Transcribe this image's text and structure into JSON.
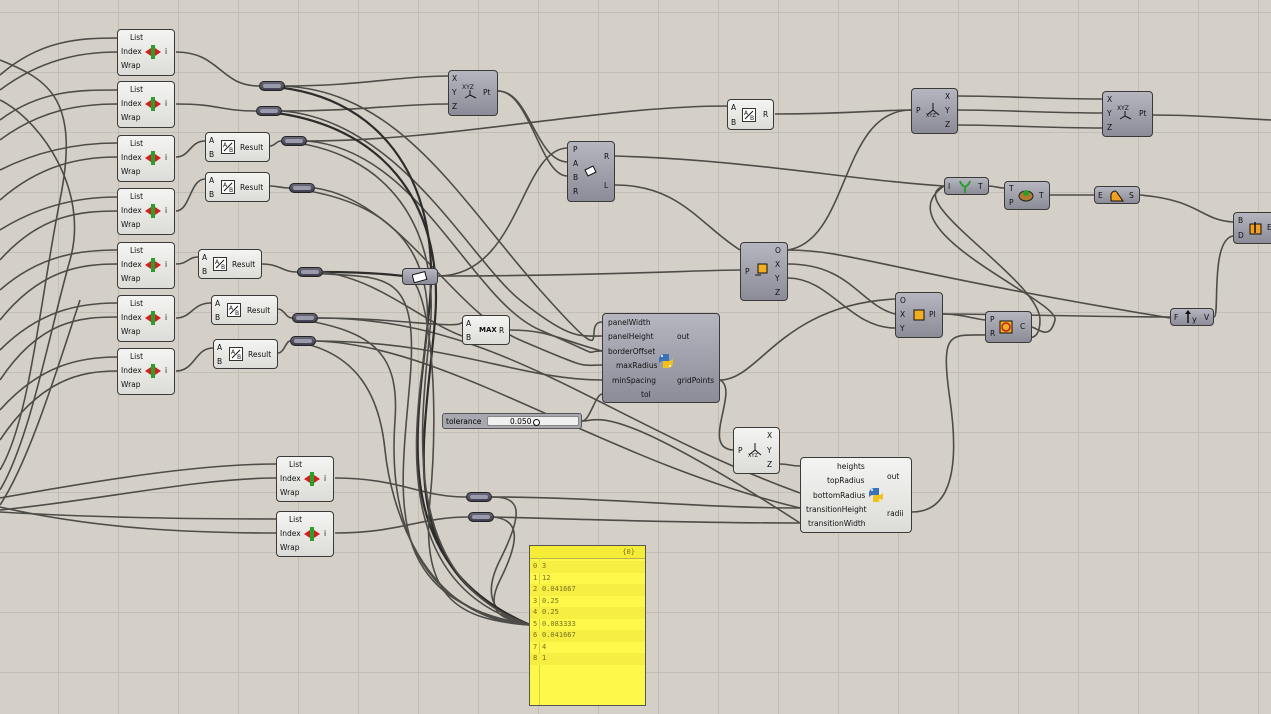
{
  "list_item": {
    "list": "List",
    "index": "Index",
    "wrap": "Wrap",
    "out": "i"
  },
  "pins": {
    "a": "A",
    "b": "B",
    "p": "P",
    "r": "R",
    "l": "L",
    "x": "X",
    "y": "Y",
    "z": "Z",
    "o": "O",
    "t": "T",
    "i": "I",
    "e": "E",
    "s": "S",
    "d": "D",
    "c": "C",
    "v": "V",
    "pt": "Pt",
    "pl": "Pl",
    "f": "F"
  },
  "division": {
    "result": "Result"
  },
  "max": {
    "label": "MAX"
  },
  "python1": {
    "inputs": [
      "panelWidth",
      "panelHeight",
      "borderOffset",
      "maxRadius",
      "minSpacing",
      "tol"
    ],
    "outputs": [
      "out",
      "gridPoints"
    ]
  },
  "python2": {
    "inputs": [
      "heights",
      "topRadius",
      "bottomRadius",
      "transitionHeight",
      "transitionWidth"
    ],
    "outputs": [
      "out",
      "radii"
    ]
  },
  "slider": {
    "name": "tolerance",
    "value": "0.050"
  },
  "panel": {
    "header": "{0}",
    "rows": [
      {
        "i": "0",
        "v": "3"
      },
      {
        "i": "1",
        "v": "12"
      },
      {
        "i": "2",
        "v": "0.041667"
      },
      {
        "i": "3",
        "v": "0.25"
      },
      {
        "i": "4",
        "v": "0.25"
      },
      {
        "i": "5",
        "v": "0.083333"
      },
      {
        "i": "6",
        "v": "0.041667"
      },
      {
        "i": "7",
        "v": "4"
      },
      {
        "i": "8",
        "v": "1"
      }
    ]
  }
}
